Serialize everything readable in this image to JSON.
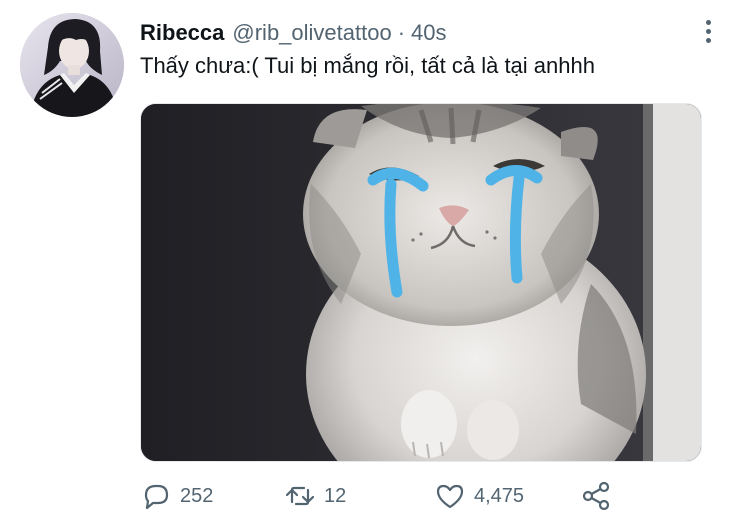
{
  "tweet": {
    "author_name": "Ribecca",
    "author_handle": "@rib_olivetattoo",
    "separator": "·",
    "timestamp": "40s",
    "text": "Thấy chưa:( Tui bị mắng rồi, tất cả là tại anhhh",
    "media": {
      "description_icon": "crying-cat-photo"
    },
    "actions": {
      "reply_count": "252",
      "retweet_count": "12",
      "like_count": "4,475"
    }
  },
  "icons": {
    "reply": "speech-bubble-icon",
    "retweet": "retweet-arrows-icon",
    "like": "heart-icon",
    "share": "share-icon",
    "more": "more-vertical-icon"
  },
  "colors": {
    "text_primary": "#0f1419",
    "text_secondary": "#536471",
    "tear_blue": "#4fb3e8"
  }
}
